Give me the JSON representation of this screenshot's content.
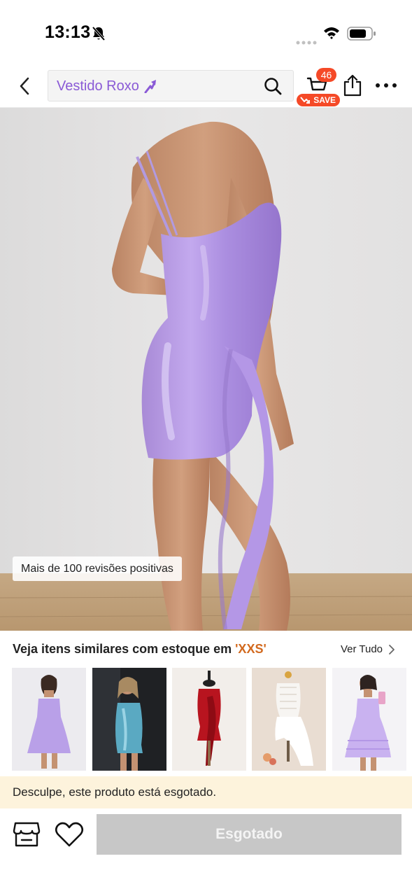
{
  "status_bar": {
    "time": "13:13",
    "icons": [
      "bell-slash-icon",
      "signal-icon",
      "wifi-icon",
      "battery-icon"
    ]
  },
  "nav": {
    "back_icon": "chevron-left-icon",
    "search_text": "Vestido Roxo",
    "trend_icon": "trending-arrow-icon",
    "search_icon": "search-icon",
    "cart_count": "46",
    "cart_save_label": "SAVE",
    "share_icon": "share-icon",
    "more_icon": "more-dots-icon"
  },
  "product": {
    "image": "lilac satin one-shoulder ruffle mini dress",
    "reviews_badge": "Mais de 100 revisões positivas"
  },
  "similar": {
    "title": "Veja itens similares com estoque em ",
    "size": "'XXS'",
    "see_all": "Ver Tudo",
    "items": [
      {
        "name": "lilac satin mini dress"
      },
      {
        "name": "teal satin bodycon dress"
      },
      {
        "name": "red satin draped dress"
      },
      {
        "name": "white lace corset dress"
      },
      {
        "name": "lilac tiered sundress"
      }
    ]
  },
  "notice": {
    "text": "Desculpe, este produto está esgotado."
  },
  "bottom": {
    "store_icon": "store-icon",
    "wishlist_icon": "heart-icon",
    "primary_button": "Esgotado"
  },
  "colors": {
    "accent_purple": "#8a5ad6",
    "badge_red": "#f54927",
    "size_orange": "#d2691e",
    "notice_bg": "#fdf3dc",
    "disabled_button": "#c7c7c7"
  }
}
